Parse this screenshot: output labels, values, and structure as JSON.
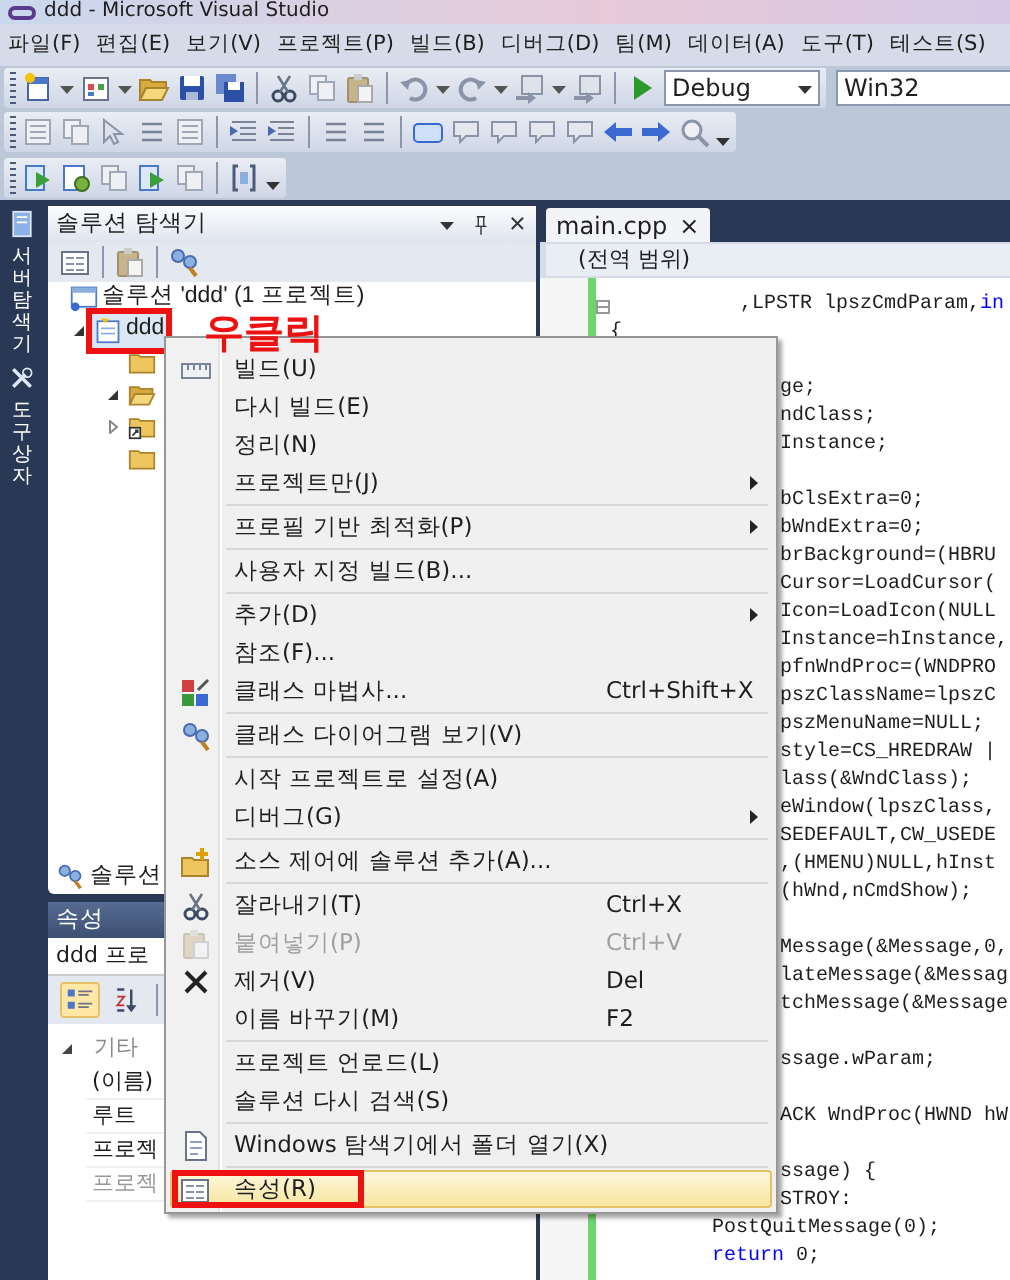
{
  "window": {
    "title": "ddd - Microsoft Visual Studio"
  },
  "menu_bar": [
    "파일(F)",
    "편집(E)",
    "보기(V)",
    "프로젝트(P)",
    "빌드(B)",
    "디버그(D)",
    "팀(M)",
    "데이터(A)",
    "도구(T)",
    "테스트(S)"
  ],
  "toolbar": {
    "configuration": "Debug",
    "platform": "Win32"
  },
  "side_strip": [
    {
      "label": "서버 탐색기"
    },
    {
      "label": "도구 상자"
    }
  ],
  "solution_explorer": {
    "title": "솔루션 탐색기",
    "tree": [
      {
        "label": "솔루션 'ddd' (1 프로젝트)",
        "selected": false,
        "children": [
          {
            "label": "ddd",
            "selected": true,
            "expanded": true,
            "annotated": true,
            "children": [
              {
                "selected": false
              },
              {
                "selected": false,
                "expanded": true
              },
              {
                "selected": false,
                "expanded": false
              },
              {
                "selected": false
              }
            ]
          }
        ]
      }
    ],
    "tabs": [
      {
        "label": "솔루션",
        "selected": true
      }
    ]
  },
  "annotation": {
    "text": "우클릭"
  },
  "properties": {
    "title": "속성",
    "object": "ddd 프로",
    "toolbar": [
      {
        "selected": true
      },
      {
        "selected": false
      }
    ],
    "rows": [
      {
        "kind": "category",
        "label": "기타",
        "expanded": true
      },
      {
        "kind": "property",
        "label": "(이름)",
        "disabled": false
      },
      {
        "kind": "property",
        "label": "루트",
        "disabled": false
      },
      {
        "kind": "property",
        "label": "프로젝",
        "disabled": false
      },
      {
        "kind": "property",
        "label": "프로젝",
        "disabled": true
      }
    ]
  },
  "editor": {
    "tabs": [
      {
        "label": "main.cpp",
        "close": "×",
        "selected": true
      }
    ],
    "scope": "(전역 범위)",
    "lines": [
      {
        "kind": "cont",
        "fold": true,
        "segments": [
          {
            "text": ",LPSTR lpszCmdParam,",
            "kind": "plain"
          },
          {
            "text": "in",
            "kind": "keyword"
          }
        ]
      },
      {
        "kind": "plain",
        "text": "{"
      },
      {
        "kind": "blank"
      },
      {
        "kind": "cut",
        "text": "ge;"
      },
      {
        "kind": "cut",
        "text": "ndClass;"
      },
      {
        "kind": "cut",
        "text": "Instance;"
      },
      {
        "kind": "blank"
      },
      {
        "kind": "cut",
        "text": "bClsExtra=0;"
      },
      {
        "kind": "cut",
        "text": "bWndExtra=0;"
      },
      {
        "kind": "cut",
        "text": "brBackground=(HBRU"
      },
      {
        "kind": "cut",
        "text": "Cursor=LoadCursor("
      },
      {
        "kind": "cut",
        "text": "Icon=LoadIcon(NULL"
      },
      {
        "kind": "cut",
        "text": "Instance=hInstance,"
      },
      {
        "kind": "cut",
        "text": "pfnWndProc=(WNDPRO"
      },
      {
        "kind": "cut",
        "text": "pszClassName=lpszC"
      },
      {
        "kind": "cut",
        "text": "pszMenuName=NULL;"
      },
      {
        "kind": "cut",
        "text": "style=CS_HREDRAW |"
      },
      {
        "kind": "cut",
        "text": "lass(&WndClass);"
      },
      {
        "kind": "cut",
        "text": "eWindow(lpszClass,"
      },
      {
        "kind": "cut",
        "text": "SEDEFAULT,CW_USEDE"
      },
      {
        "kind": "cut",
        "text": ",(HMENU)NULL,hInst"
      },
      {
        "kind": "cut",
        "text": "(hWnd,nCmdShow);"
      },
      {
        "kind": "blank"
      },
      {
        "kind": "cut",
        "text": "Message(&Message,0,"
      },
      {
        "kind": "cut",
        "text": "lateMessage(&Messag"
      },
      {
        "kind": "cut",
        "text": "tchMessage(&Message"
      },
      {
        "kind": "blank"
      },
      {
        "kind": "cut",
        "text": "ssage.wParam;"
      },
      {
        "kind": "blank"
      },
      {
        "kind": "cut",
        "text": "ACK WndProc(HWND hW"
      },
      {
        "kind": "blank"
      },
      {
        "kind": "cut",
        "text": "ssage) {"
      },
      {
        "kind": "cut",
        "text": "STROY:"
      },
      {
        "kind": "body",
        "text": "PostQuitMessage(0);"
      },
      {
        "kind": "body",
        "segments": [
          {
            "text": "return",
            "kind": "keyword"
          },
          {
            "text": " 0;",
            "kind": "plain"
          }
        ]
      }
    ]
  },
  "context_menu": {
    "groups": [
      [
        {
          "label": "빌드(U)",
          "submenu": false,
          "disabled": false,
          "selected": false
        },
        {
          "label": "다시 빌드(E)",
          "submenu": false,
          "disabled": false,
          "selected": false
        },
        {
          "label": "정리(N)",
          "submenu": false,
          "disabled": false,
          "selected": false
        },
        {
          "label": "프로젝트만(J)",
          "submenu": true,
          "disabled": false,
          "selected": false
        }
      ],
      [
        {
          "label": "프로필 기반 최적화(P)",
          "submenu": true,
          "disabled": false,
          "selected": false
        }
      ],
      [
        {
          "label": "사용자 지정 빌드(B)...",
          "submenu": false,
          "disabled": false,
          "selected": false
        }
      ],
      [
        {
          "label": "추가(D)",
          "submenu": true,
          "disabled": false,
          "selected": false
        },
        {
          "label": "참조(F)...",
          "submenu": false,
          "disabled": false,
          "selected": false
        },
        {
          "label": "클래스 마법사...",
          "shortcut": "Ctrl+Shift+X",
          "submenu": false,
          "disabled": false,
          "selected": false
        }
      ],
      [
        {
          "label": "클래스 다이어그램 보기(V)",
          "submenu": false,
          "disabled": false,
          "selected": false
        }
      ],
      [
        {
          "label": "시작 프로젝트로 설정(A)",
          "submenu": false,
          "disabled": false,
          "selected": false
        },
        {
          "label": "디버그(G)",
          "submenu": true,
          "disabled": false,
          "selected": false
        }
      ],
      [
        {
          "label": "소스 제어에 솔루션 추가(A)...",
          "submenu": false,
          "disabled": false,
          "selected": false
        }
      ],
      [
        {
          "label": "잘라내기(T)",
          "shortcut": "Ctrl+X",
          "submenu": false,
          "disabled": false,
          "selected": false
        },
        {
          "label": "붙여넣기(P)",
          "shortcut": "Ctrl+V",
          "submenu": false,
          "disabled": true,
          "selected": false
        },
        {
          "label": "제거(V)",
          "shortcut": "Del",
          "submenu": false,
          "disabled": false,
          "selected": false
        },
        {
          "label": "이름 바꾸기(M)",
          "shortcut": "F2",
          "submenu": false,
          "disabled": false,
          "selected": false
        }
      ],
      [
        {
          "label": "프로젝트 언로드(L)",
          "submenu": false,
          "disabled": false,
          "selected": false
        },
        {
          "label": "솔루션 다시 검색(S)",
          "submenu": false,
          "disabled": false,
          "selected": false
        }
      ],
      [
        {
          "label": "Windows 탐색기에서 폴더 열기(X)",
          "submenu": false,
          "disabled": false,
          "selected": false
        }
      ],
      [
        {
          "label": "속성(R)",
          "submenu": false,
          "disabled": false,
          "selected": true,
          "annotated": true
        }
      ]
    ]
  }
}
